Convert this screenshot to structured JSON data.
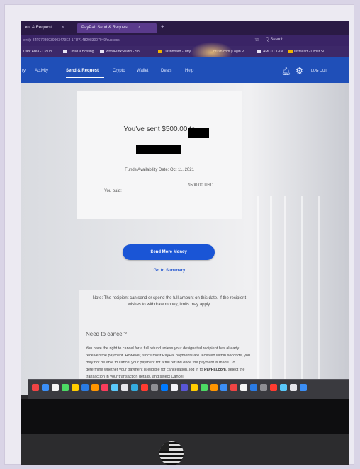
{
  "browser": {
    "tabs": [
      {
        "label": "ent & Request"
      },
      {
        "label": "PayPal: Send & Request"
      }
    ],
    "url": "ent/p-84F97280039903479EJ-1FU?1482983007949/success",
    "search_hint": "Q Search",
    "bookmarks": [
      {
        "label": "Dark Area - Cloud ..."
      },
      {
        "label": "Cloud 9 Hosting"
      },
      {
        "label": "WordFunkStudio - Sol ..."
      },
      {
        "label": "Dashboard - Tiny ..."
      },
      {
        "label": "brush.com (Login P..."
      },
      {
        "label": "AMC LOGIN"
      },
      {
        "label": "Instacart - Order Su..."
      }
    ]
  },
  "paypal_nav": {
    "items": [
      "ry",
      "Activity",
      "Send & Request",
      "Crypto",
      "Wallet",
      "Deals",
      "Help"
    ],
    "logout": "LOG OUT"
  },
  "confirmation": {
    "sent_text": "You've sent $500.00 to",
    "funds_date": "Funds Availability Date: Oct 11, 2021",
    "paid_label": "You paid:",
    "paid_value": "$500.00 USD"
  },
  "actions": {
    "send_more": "Send More Money",
    "summary": "Go to Summary"
  },
  "note": {
    "text": "Note: The recipient can send or spend the full amount on this date. If the recipient wishes to withdraw money, limits may apply.",
    "cancel_heading": "Need to cancel?",
    "cancel_body_1": "You have the right to cancel for a full refund unless your designated recipient has already received the payment. However, since most PayPal payments are received within seconds, you may not be able to cancel your payment for a full refund once the payment is made. To determine whether your payment is eligible for cancellation, log in to",
    "cancel_link": "PayPal.com",
    "cancel_body_2": ", select the transaction in your transaction details, and select Cancel."
  },
  "colors": {
    "paypal_blue": "#1f4fb8",
    "button_blue": "#1a55d6",
    "browser_purple": "#2a1a45"
  }
}
